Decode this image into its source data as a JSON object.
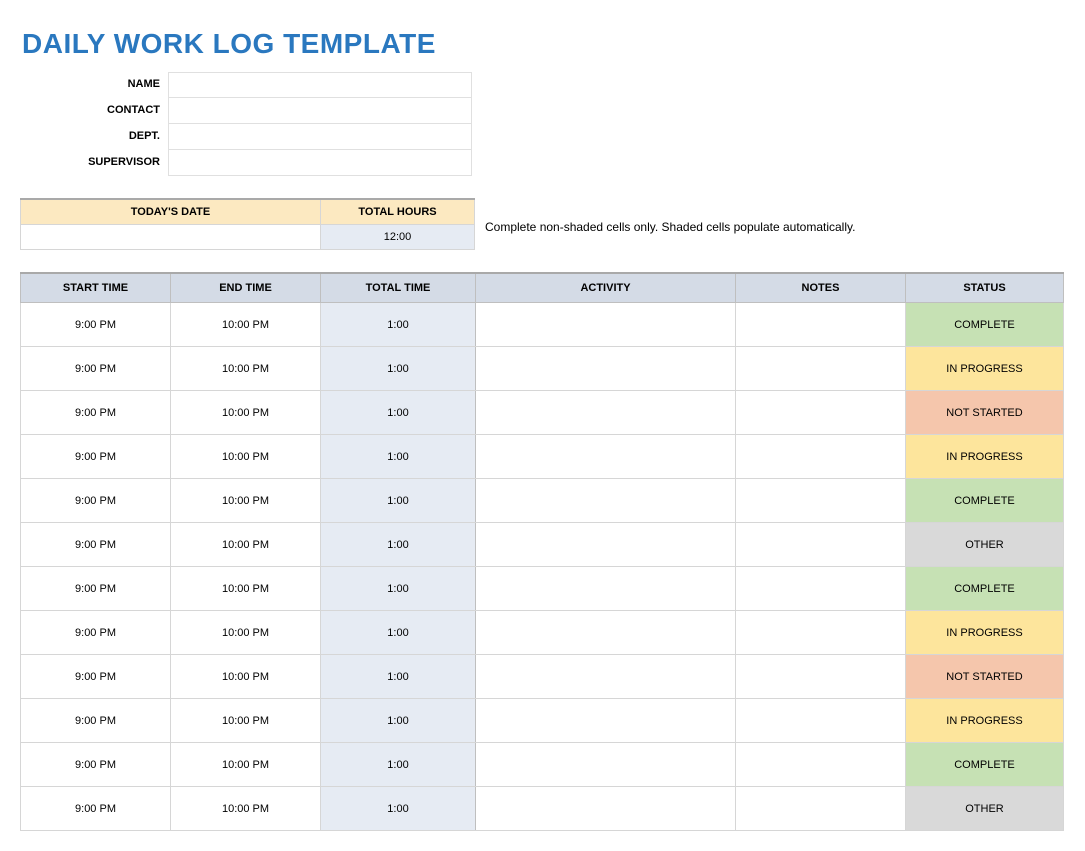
{
  "title": "DAILY WORK LOG TEMPLATE",
  "meta": {
    "name_label": "NAME",
    "contact_label": "CONTACT",
    "dept_label": "DEPT.",
    "supervisor_label": "SUPERVISOR",
    "name_value": "",
    "contact_value": "",
    "dept_value": "",
    "supervisor_value": ""
  },
  "summary": {
    "date_header": "TODAY'S DATE",
    "hours_header": "TOTAL HOURS",
    "date_value": "",
    "hours_value": "12:00"
  },
  "instructions": "Complete non-shaded cells only. Shaded cells populate automatically.",
  "columns": {
    "start": "START TIME",
    "end": "END TIME",
    "total": "TOTAL TIME",
    "activity": "ACTIVITY",
    "notes": "NOTES",
    "status": "STATUS"
  },
  "status_styles": {
    "COMPLETE": "s-complete",
    "IN PROGRESS": "s-inprogress",
    "NOT STARTED": "s-notstarted",
    "OTHER": "s-other"
  },
  "rows": [
    {
      "start": "9:00 PM",
      "end": "10:00 PM",
      "total": "1:00",
      "activity": "",
      "notes": "",
      "status": "COMPLETE"
    },
    {
      "start": "9:00 PM",
      "end": "10:00 PM",
      "total": "1:00",
      "activity": "",
      "notes": "",
      "status": "IN PROGRESS"
    },
    {
      "start": "9:00 PM",
      "end": "10:00 PM",
      "total": "1:00",
      "activity": "",
      "notes": "",
      "status": "NOT STARTED"
    },
    {
      "start": "9:00 PM",
      "end": "10:00 PM",
      "total": "1:00",
      "activity": "",
      "notes": "",
      "status": "IN PROGRESS"
    },
    {
      "start": "9:00 PM",
      "end": "10:00 PM",
      "total": "1:00",
      "activity": "",
      "notes": "",
      "status": "COMPLETE"
    },
    {
      "start": "9:00 PM",
      "end": "10:00 PM",
      "total": "1:00",
      "activity": "",
      "notes": "",
      "status": "OTHER"
    },
    {
      "start": "9:00 PM",
      "end": "10:00 PM",
      "total": "1:00",
      "activity": "",
      "notes": "",
      "status": "COMPLETE"
    },
    {
      "start": "9:00 PM",
      "end": "10:00 PM",
      "total": "1:00",
      "activity": "",
      "notes": "",
      "status": "IN PROGRESS"
    },
    {
      "start": "9:00 PM",
      "end": "10:00 PM",
      "total": "1:00",
      "activity": "",
      "notes": "",
      "status": "NOT STARTED"
    },
    {
      "start": "9:00 PM",
      "end": "10:00 PM",
      "total": "1:00",
      "activity": "",
      "notes": "",
      "status": "IN PROGRESS"
    },
    {
      "start": "9:00 PM",
      "end": "10:00 PM",
      "total": "1:00",
      "activity": "",
      "notes": "",
      "status": "COMPLETE"
    },
    {
      "start": "9:00 PM",
      "end": "10:00 PM",
      "total": "1:00",
      "activity": "",
      "notes": "",
      "status": "OTHER"
    }
  ]
}
